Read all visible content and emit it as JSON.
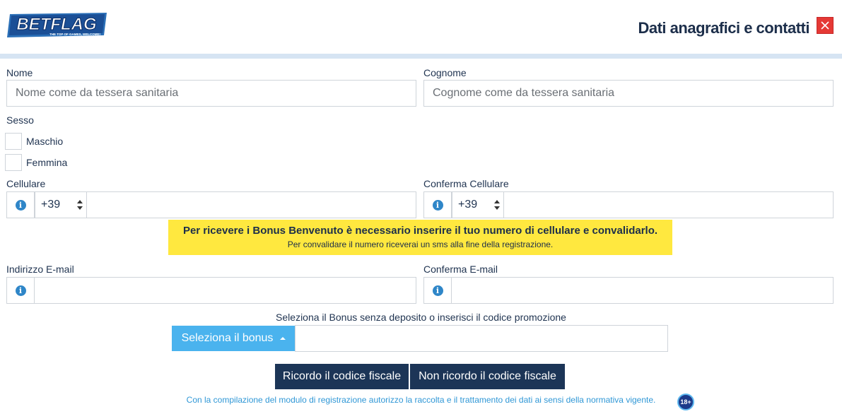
{
  "header": {
    "logo_text": "BETFLAG",
    "logo_tagline": "THE TOP OF GAMES, WELCOME!",
    "title": "Dati anagrafici e contatti",
    "close_icon": "close-icon"
  },
  "form": {
    "nome": {
      "label": "Nome",
      "placeholder": "Nome come da tessera sanitaria",
      "value": ""
    },
    "cognome": {
      "label": "Cognome",
      "placeholder": "Cognome come da tessera sanitaria",
      "value": ""
    },
    "sesso": {
      "label": "Sesso",
      "options": [
        {
          "label": "Maschio",
          "checked": false
        },
        {
          "label": "Femmina",
          "checked": false
        }
      ]
    },
    "cellulare": {
      "label": "Cellulare",
      "prefix": "+39",
      "value": "",
      "icon": "info-icon"
    },
    "conferma_cellulare": {
      "label": "Conferma Cellulare",
      "prefix": "+39",
      "value": "",
      "icon": "info-icon"
    },
    "email": {
      "label": "Indirizzo E-mail",
      "value": "",
      "icon": "info-icon"
    },
    "conferma_email": {
      "label": "Conferma E-mail",
      "value": "",
      "icon": "info-icon"
    }
  },
  "notice": {
    "main": "Per ricevere i Bonus Benvenuto è necessario inserire il tuo numero di cellulare e convalidarlo.",
    "sub": "Per convalidare il numero riceverai un sms alla fine della registrazione."
  },
  "bonus": {
    "caption": "Seleziona il Bonus senza deposito o inserisci il codice promozione",
    "select_label": "Seleziona il bonus",
    "code_value": ""
  },
  "buttons": {
    "ricordo_cf": "Ricordo il codice fiscale",
    "non_ricordo_cf": "Non ricordo il codice fiscale"
  },
  "footer": {
    "note": "Con la compilazione del modulo di registrazione autorizzo la raccolta e il trattamento dei dati ai sensi della normativa vigente.",
    "age_badge": "18+"
  },
  "colors": {
    "primary_dark": "#1c3557",
    "accent_blue": "#4ab3ee",
    "notice_yellow": "#ffe83f",
    "close_red": "#e53935",
    "link_blue": "#2f97d6"
  }
}
